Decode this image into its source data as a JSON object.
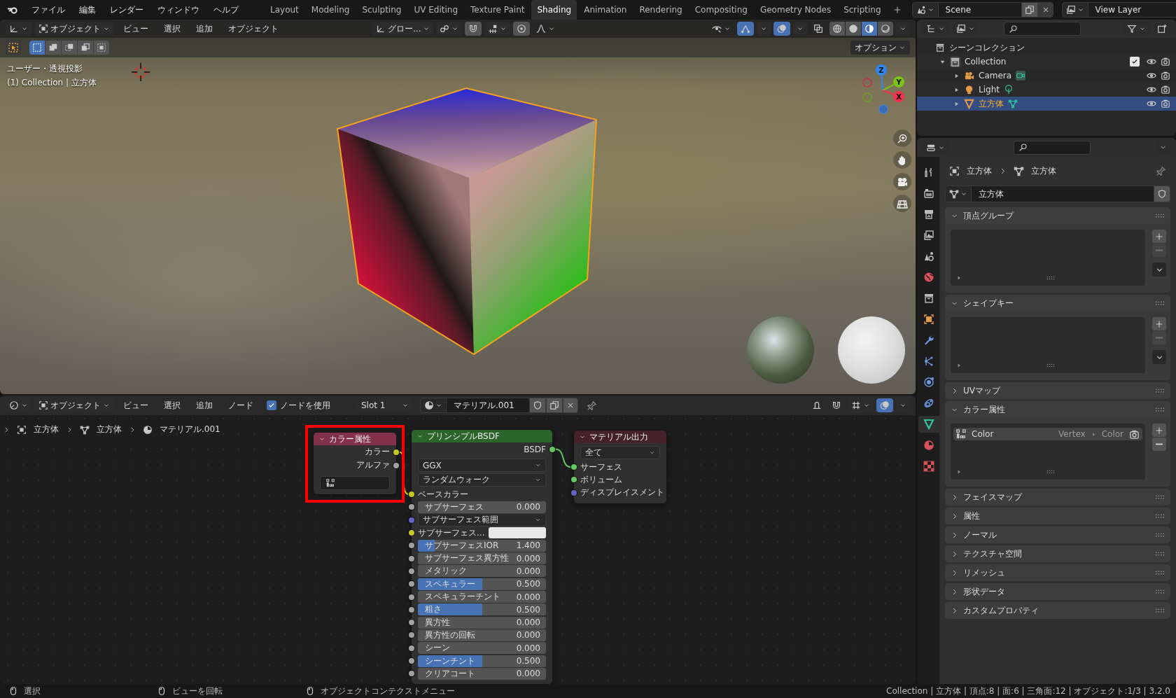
{
  "topbar": {
    "menus": [
      "ファイル",
      "編集",
      "レンダー",
      "ウィンドウ",
      "ヘルプ"
    ],
    "workspaces": [
      {
        "label": "Layout",
        "selected": false
      },
      {
        "label": "Modeling",
        "selected": false
      },
      {
        "label": "Sculpting",
        "selected": false
      },
      {
        "label": "UV Editing",
        "selected": false
      },
      {
        "label": "Texture Paint",
        "selected": false
      },
      {
        "label": "Shading",
        "selected": true
      },
      {
        "label": "Animation",
        "selected": false
      },
      {
        "label": "Rendering",
        "selected": false
      },
      {
        "label": "Compositing",
        "selected": false
      },
      {
        "label": "Geometry Nodes",
        "selected": false
      },
      {
        "label": "Scripting",
        "selected": false
      }
    ],
    "scene": "Scene",
    "view_layer": "View Layer"
  },
  "viewport": {
    "header": {
      "mode": "オブジェクト",
      "menus": [
        "ビュー",
        "選択",
        "追加",
        "オブジェクト"
      ],
      "transform_orientation": "グロー...",
      "shading_modes": [
        {
          "kind": "wireframe",
          "selected": false
        },
        {
          "kind": "solid",
          "selected": false
        },
        {
          "kind": "material",
          "selected": true
        },
        {
          "kind": "rendered",
          "selected": false
        }
      ]
    },
    "tool_header": {
      "select_modes": [
        {
          "selected": true
        },
        {
          "selected": false
        },
        {
          "selected": false
        },
        {
          "selected": false
        },
        {
          "selected": false
        }
      ],
      "options": "オプション"
    },
    "overlay": {
      "view_name": "ユーザー・透視投影",
      "object_info": "(1) Collection | 立方体"
    },
    "gizmo_axes": [
      {
        "label": "Z",
        "color": "#2e86f0"
      },
      {
        "label": "Y",
        "color": "#7cc318"
      },
      {
        "label": "X",
        "color": "#f0344f"
      }
    ]
  },
  "node_editor": {
    "header": {
      "mode": "オブジェクト",
      "menus": [
        "ビュー",
        "選択",
        "追加",
        "ノード"
      ],
      "use_nodes": {
        "label": "ノードを使用",
        "checked": true
      },
      "slot": "Slot 1",
      "material": "マテリアル.001"
    },
    "breadcrumb": [
      {
        "kind": "object",
        "label": "立方体"
      },
      {
        "kind": "mesh",
        "label": "立方体"
      },
      {
        "kind": "material",
        "label": "マテリアル.001"
      }
    ],
    "nodes": [
      {
        "title": "カラー属性",
        "color": "#83314a",
        "highlighted": true,
        "outputs": [
          {
            "label": "カラー",
            "color": "#c7c729",
            "linked": true
          },
          {
            "label": "アルファ",
            "color": "#a1a1a1"
          }
        ],
        "attribute_field": true
      },
      {
        "title": "プリンシプルBSDF",
        "color": "#2b652b",
        "highlighted": false,
        "outputs": [
          {
            "label": "BSDF",
            "color": "#63c763",
            "linked": true
          }
        ],
        "dropdowns": [
          "GGX",
          "ランダムウォーク"
        ],
        "inputs": [
          {
            "kind": "socket",
            "label": "ベースカラー",
            "color": "#c7c729",
            "linked": true
          },
          {
            "kind": "slider",
            "label": "サブサーフェス",
            "value": "0.000",
            "level": 0,
            "color": "#a1a1a1"
          },
          {
            "kind": "dropdown",
            "label": "サブサーフェス範囲",
            "color": "#6363c7"
          },
          {
            "kind": "color",
            "label": "サブサーフェス...",
            "color": "#c7c729"
          },
          {
            "kind": "slider",
            "label": "サブサーフェスIOR",
            "value": "1.400",
            "level": 0.13,
            "color": "#a1a1a1"
          },
          {
            "kind": "slider",
            "label": "サブサーフェス異方性",
            "value": "0.000",
            "level": 0,
            "color": "#a1a1a1"
          },
          {
            "kind": "slider",
            "label": "メタリック",
            "value": "0.000",
            "level": 0,
            "color": "#a1a1a1"
          },
          {
            "kind": "slider",
            "label": "スペキュラー",
            "value": "0.500",
            "level": 0.5,
            "color": "#a1a1a1"
          },
          {
            "kind": "slider",
            "label": "スペキュラーチント",
            "value": "0.000",
            "level": 0,
            "color": "#a1a1a1"
          },
          {
            "kind": "slider",
            "label": "粗さ",
            "value": "0.500",
            "level": 0.5,
            "color": "#a1a1a1"
          },
          {
            "kind": "slider",
            "label": "異方性",
            "value": "0.000",
            "level": 0,
            "color": "#a1a1a1"
          },
          {
            "kind": "slider",
            "label": "異方性の回転",
            "value": "0.000",
            "level": 0,
            "color": "#a1a1a1"
          },
          {
            "kind": "slider",
            "label": "シーン",
            "value": "0.000",
            "level": 0,
            "color": "#a1a1a1"
          },
          {
            "kind": "slider",
            "label": "シーンチント",
            "value": "0.500",
            "level": 0.5,
            "color": "#a1a1a1"
          },
          {
            "kind": "slider",
            "label": "クリアコート",
            "value": "0.000",
            "level": 0,
            "color": "#a1a1a1"
          }
        ]
      },
      {
        "title": "マテリアル出力",
        "color": "#45222a",
        "highlighted": false,
        "dropdowns": [
          "全て"
        ],
        "inputs": [
          {
            "kind": "socket",
            "label": "サーフェス",
            "color": "#63c763",
            "linked": true
          },
          {
            "kind": "socket",
            "label": "ボリューム",
            "color": "#63c763"
          },
          {
            "kind": "socket",
            "label": "ディスプレイスメント",
            "color": "#6363c7"
          }
        ]
      }
    ]
  },
  "outliner": {
    "root": "シーンコレクション",
    "children": [
      {
        "kind": "collection",
        "label": "Collection",
        "expanded": true,
        "checked": true,
        "visible": true,
        "renderable": true,
        "selected": false,
        "children": [
          {
            "kind": "camera",
            "label": "Camera",
            "expanded": false,
            "visible": true,
            "renderable": true,
            "selected": false
          },
          {
            "kind": "light",
            "label": "Light",
            "expanded": false,
            "visible": true,
            "renderable": true,
            "selected": false
          },
          {
            "kind": "mesh",
            "label": "立方体",
            "expanded": false,
            "visible": true,
            "renderable": true,
            "selected": true
          }
        ]
      }
    ]
  },
  "properties": {
    "tabs": [
      {
        "kind": "tool",
        "selected": false
      },
      {
        "kind": "render",
        "selected": false
      },
      {
        "kind": "output",
        "selected": false
      },
      {
        "kind": "view_layer",
        "selected": false
      },
      {
        "kind": "scene",
        "selected": false
      },
      {
        "kind": "world",
        "selected": false
      },
      {
        "kind": "collection",
        "selected": false
      },
      {
        "kind": "object",
        "selected": false
      },
      {
        "kind": "modifiers",
        "selected": false
      },
      {
        "kind": "particles",
        "selected": false
      },
      {
        "kind": "physics",
        "selected": false
      },
      {
        "kind": "constraints",
        "selected": false
      },
      {
        "kind": "data",
        "selected": true
      },
      {
        "kind": "material",
        "selected": false
      },
      {
        "kind": "texture",
        "selected": false
      }
    ],
    "breadcrumb": [
      {
        "kind": "object",
        "label": "立方体"
      },
      {
        "kind": "mesh",
        "label": "立方体"
      }
    ],
    "mesh_name": "立方体",
    "panels": [
      {
        "title": "頂点グループ",
        "expanded": true
      },
      {
        "title": "シェイプキー",
        "expanded": true
      },
      {
        "title": "UVマップ",
        "expanded": false
      },
      {
        "title": "カラー属性",
        "expanded": true,
        "items": [
          {
            "name": "Color",
            "domain": "Vertex",
            "type": "Color",
            "selected": true
          }
        ]
      },
      {
        "title": "フェイスマップ",
        "expanded": false
      },
      {
        "title": "属性",
        "expanded": false
      },
      {
        "title": "ノーマル",
        "expanded": false
      },
      {
        "title": "テクスチャ空間",
        "expanded": false
      },
      {
        "title": "リメッシュ",
        "expanded": false
      },
      {
        "title": "形状データ",
        "expanded": false
      },
      {
        "title": "カスタムプロパティ",
        "expanded": false
      }
    ]
  },
  "status_bar": {
    "hints": [
      "選択",
      "ビューを回転",
      "オブジェクトコンテクストメニュー"
    ],
    "stats": "Collection | 立方体 | 頂点:8 | 面:6 | 三角面:12 | オブジェクト:1/3 | 3.2.0"
  }
}
